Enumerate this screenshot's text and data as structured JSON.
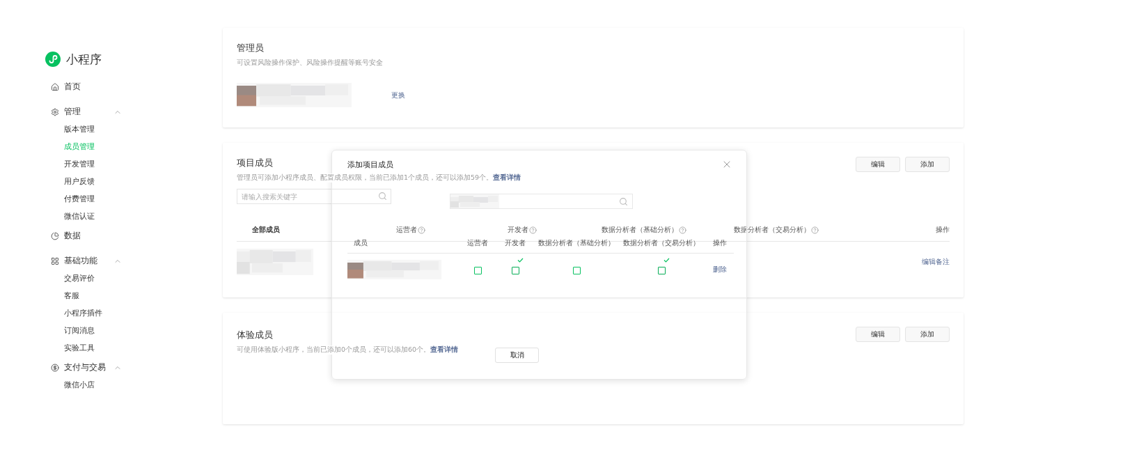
{
  "sidebar": {
    "logo": "小程序",
    "sections": [
      {
        "label": "首页",
        "kind": "home"
      },
      {
        "label": "管理",
        "kind": "settings",
        "expanded": true,
        "children": [
          {
            "label": "版本管理",
            "selected": false
          },
          {
            "label": "成员管理",
            "selected": true
          },
          {
            "label": "开发管理",
            "selected": false
          },
          {
            "label": "用户反馈",
            "selected": false
          },
          {
            "label": "付费管理",
            "selected": false
          },
          {
            "label": "微信认证",
            "selected": false
          }
        ]
      },
      {
        "label": "数据",
        "kind": "chart"
      },
      {
        "label": "基础功能",
        "kind": "grid",
        "expanded": true,
        "children": [
          {
            "label": "交易评价",
            "selected": false
          },
          {
            "label": "客服",
            "selected": false
          },
          {
            "label": "小程序插件",
            "selected": false
          },
          {
            "label": "订阅消息",
            "selected": false
          },
          {
            "label": "实验工具",
            "selected": false
          }
        ]
      },
      {
        "label": "支付与交易",
        "kind": "pay",
        "expanded": true,
        "children": [
          {
            "label": "微信小店",
            "selected": false
          }
        ]
      }
    ]
  },
  "admin_card": {
    "title": "管理员",
    "description": "可设置风险操作保护、风险操作提醒等账号安全",
    "action": "更换"
  },
  "members_card": {
    "title": "项目成员",
    "description": "管理员可添加小程序成员、配置成员权限，当前已添加1个成员，还可以添加59个。",
    "link": "查看详情",
    "buttons": [
      "编辑",
      "添加"
    ],
    "search": {
      "placeholder": "请输入搜索关键字"
    },
    "columns": [
      {
        "label": "全部成员",
        "help": false
      },
      {
        "label": "运营者",
        "help": true
      },
      {
        "label": "开发者",
        "help": true
      },
      {
        "label": "数据分析者（基础分析）",
        "help": true
      },
      {
        "label": "数据分析者（交易分析）",
        "help": true
      },
      {
        "label": "操作",
        "help": false
      }
    ],
    "rows": [
      {
        "action": "编辑备注"
      }
    ]
  },
  "tester_card": {
    "title": "体验成员",
    "description": "可使用体验版小程序，当前已添加0个成员，还可以添加60个。",
    "link": "查看详情",
    "buttons": [
      "编辑",
      "添加"
    ]
  },
  "dialog": {
    "title": "添加项目成员",
    "columns": [
      "成员",
      "运营者",
      "开发者",
      "数据分析者（基础分析）",
      "数据分析者（交易分析）",
      "操作"
    ],
    "rows": [
      {
        "roles": [
          {
            "checked": false
          },
          {
            "checked": true
          },
          {
            "checked": false
          },
          {
            "checked": true
          }
        ],
        "action": "删除"
      }
    ],
    "cancel": "取消"
  }
}
